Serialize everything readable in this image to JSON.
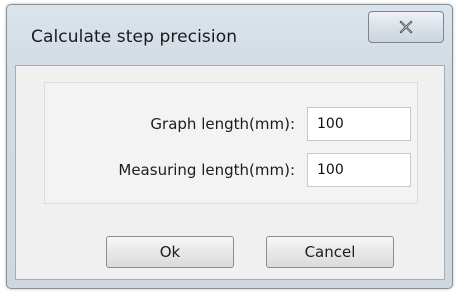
{
  "window": {
    "title": "Calculate step precision"
  },
  "fields": [
    {
      "label": "Graph length(mm):",
      "value": "100"
    },
    {
      "label": "Measuring length(mm):",
      "value": "100"
    }
  ],
  "buttons": {
    "ok_label": "Ok",
    "cancel_label": "Cancel"
  },
  "icons": {
    "close": "close-icon"
  },
  "colors": {
    "titlebar": "#d3dbe5",
    "client": "#f0f0f0",
    "input_bg": "#ffffff"
  }
}
